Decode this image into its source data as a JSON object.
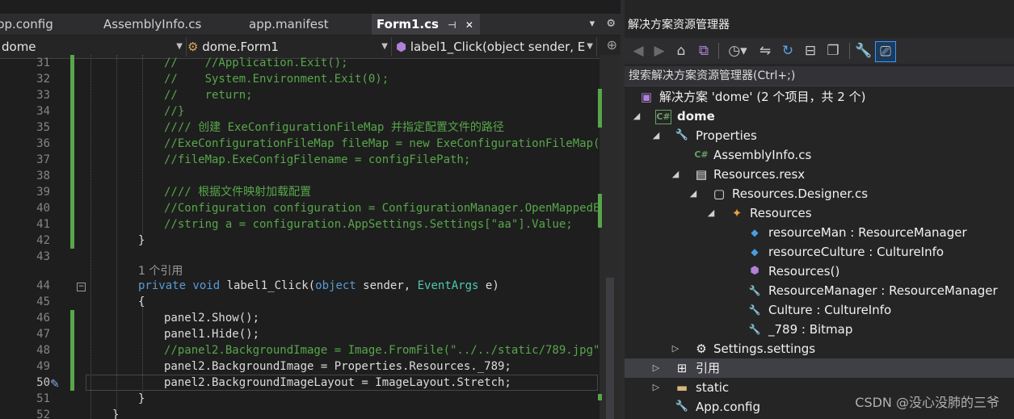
{
  "editor": {
    "tabs": [
      "pp.config",
      "AssemblyInfo.cs",
      "app.manifest",
      "Form1.cs"
    ],
    "active_tab": "Form1.cs",
    "active_tab_pin": "⊣",
    "active_tab_close": "✕",
    "tab_overflow": "▾",
    "tab_settings": "⚙",
    "nav": {
      "project": "dome",
      "class": "dome.Form1",
      "member": "label1_Click(object sender, E"
    },
    "code_lines": [
      {
        "n": "31",
        "text": "//    //Application.Exit();"
      },
      {
        "n": "32",
        "text": "//    System.Environment.Exit(0);"
      },
      {
        "n": "33",
        "text": "//    return;"
      },
      {
        "n": "34",
        "text": "//}"
      },
      {
        "n": "35",
        "text": "//// 创建 ExeConfigurationFileMap 并指定配置文件的路径"
      },
      {
        "n": "36",
        "text": "//ExeConfigurationFileMap fileMap = new ExeConfigurationFileMap();"
      },
      {
        "n": "37",
        "text": "//fileMap.ExeConfigFilename = configFilePath;"
      },
      {
        "n": "38",
        "text": ""
      },
      {
        "n": "39",
        "text": "//// 根据文件映射加载配置"
      },
      {
        "n": "40",
        "text": "//Configuration configuration = ConfigurationManager.OpenMappedExeC"
      },
      {
        "n": "41",
        "text": "//string a = configuration.AppSettings.Settings[\"aa\"].Value;"
      },
      {
        "n": "42",
        "text": "}"
      },
      {
        "n": "43",
        "text": ""
      },
      {
        "n": "",
        "text": "1 个引用"
      },
      {
        "n": "44",
        "text": "private void label1_Click(object sender, EventArgs e)"
      },
      {
        "n": "45",
        "text": "{"
      },
      {
        "n": "46",
        "text": "panel2.Show();"
      },
      {
        "n": "47",
        "text": "panel1.Hide();"
      },
      {
        "n": "48",
        "text": "//panel2.BackgroundImage = Image.FromFile(\"../../static/789.jpg\");"
      },
      {
        "n": "49",
        "text": "panel2.BackgroundImage = Properties.Resources._789;"
      },
      {
        "n": "50",
        "text": "panel2.BackgroundImageLayout = ImageLayout.Stretch;"
      },
      {
        "n": "51",
        "text": "}"
      },
      {
        "n": "52",
        "text": "}"
      }
    ]
  },
  "solution_explorer": {
    "title": "解决方案资源管理器",
    "title_controls": "▾ ⊣ ✕",
    "search_placeholder": "搜索解决方案资源管理器(Ctrl+;)",
    "tree": [
      {
        "label": "解决方案 'dome' (2 个项目，共 2 个)",
        "icon": "solution-icon",
        "glyph": "▣"
      },
      {
        "label": "dome",
        "icon": "csharp-project-icon",
        "glyph": "C#"
      },
      {
        "label": "Properties",
        "icon": "wrench-icon",
        "glyph": "🔧"
      },
      {
        "label": "AssemblyInfo.cs",
        "icon": "csharp-file-icon",
        "glyph": "C#"
      },
      {
        "label": "Resources.resx",
        "icon": "resx-file-icon",
        "glyph": "▤"
      },
      {
        "label": "Resources.Designer.cs",
        "icon": "designer-file-icon",
        "glyph": "▢"
      },
      {
        "label": "Resources",
        "icon": "class-icon",
        "glyph": "✦"
      },
      {
        "label": "resourceMan : ResourceManager",
        "icon": "field-icon",
        "glyph": "◆"
      },
      {
        "label": "resourceCulture : CultureInfo",
        "icon": "field-icon",
        "glyph": "◆"
      },
      {
        "label": "Resources()",
        "icon": "method-icon",
        "glyph": "⬢"
      },
      {
        "label": "ResourceManager : ResourceManager",
        "icon": "property-icon",
        "glyph": "🔧"
      },
      {
        "label": "Culture : CultureInfo",
        "icon": "property-icon",
        "glyph": "🔧"
      },
      {
        "label": "_789 : Bitmap",
        "icon": "property-icon",
        "glyph": "🔧"
      },
      {
        "label": "Settings.settings",
        "icon": "settings-icon",
        "glyph": "⚙"
      },
      {
        "label": "引用",
        "icon": "references-icon",
        "glyph": "⊞"
      },
      {
        "label": "static",
        "icon": "folder-icon",
        "glyph": "▬"
      },
      {
        "label": "App.config",
        "icon": "config-file-icon",
        "glyph": "🔧"
      }
    ]
  },
  "watermark": "CSDN @没心没肺的三爷",
  "colors": {
    "accent": "#3399ff",
    "comment": "#57a64a",
    "keyword": "#569cd6",
    "type": "#4ec9b0",
    "background": "#1e1e1e"
  }
}
